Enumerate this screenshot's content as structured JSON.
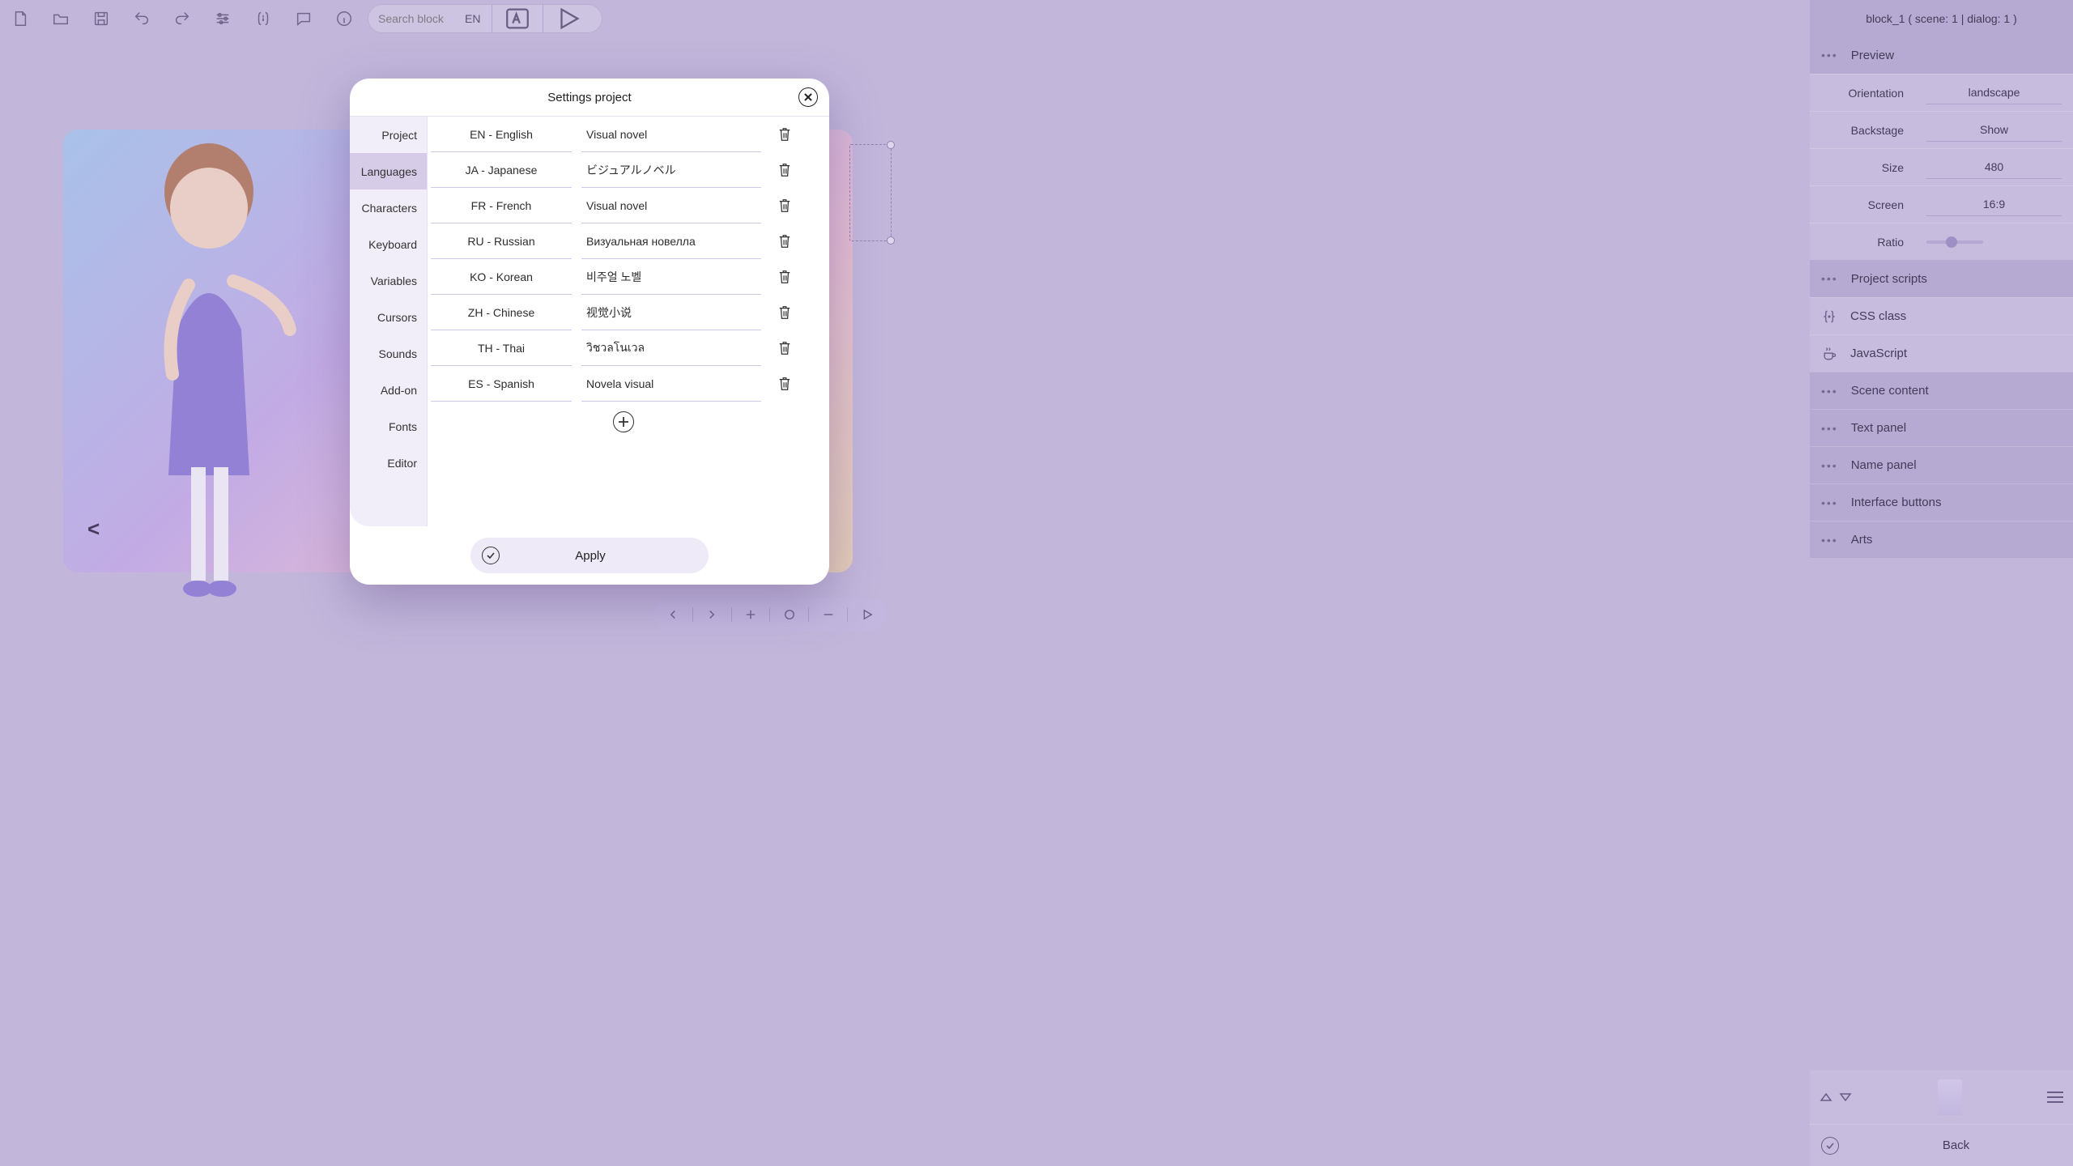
{
  "toolbar": {
    "search_placeholder": "Search block",
    "lang": "EN"
  },
  "infobar": "block_1 ( scene: 1 | dialog: 1 )",
  "side": {
    "preview": {
      "title": "Preview",
      "orientation_lab": "Orientation",
      "orientation_val": "landscape",
      "backstage_lab": "Backstage",
      "backstage_val": "Show",
      "size_lab": "Size",
      "size_val": "480",
      "screen_lab": "Screen",
      "screen_val": "16:9",
      "ratio_lab": "Ratio"
    },
    "scripts": {
      "title": "Project scripts",
      "css": "CSS class",
      "js": "JavaScript"
    },
    "sections": {
      "scene": "Scene content",
      "text": "Text panel",
      "name": "Name panel",
      "iface": "Interface buttons",
      "arts": "Arts"
    },
    "back": "Back"
  },
  "modal": {
    "title": "Settings project",
    "tabs": [
      "Project",
      "Languages",
      "Characters",
      "Keyboard",
      "Variables",
      "Cursors",
      "Sounds",
      "Add-on",
      "Fonts",
      "Editor"
    ],
    "active_tab": 1,
    "languages": [
      {
        "code": "EN - English",
        "title": "Visual novel"
      },
      {
        "code": "JA - Japanese",
        "title": "ビジュアルノベル"
      },
      {
        "code": "FR - French",
        "title": "Visual novel"
      },
      {
        "code": "RU - Russian",
        "title": "Визуальная новелла"
      },
      {
        "code": "KO - Korean",
        "title": "비주얼 노벨"
      },
      {
        "code": "ZH - Chinese",
        "title": "视觉小说"
      },
      {
        "code": "TH - Thai",
        "title": "วิชวลโนเวล"
      },
      {
        "code": "ES - Spanish",
        "title": "Novela visual"
      }
    ],
    "apply": "Apply"
  },
  "canvas": {
    "prev": "<"
  }
}
